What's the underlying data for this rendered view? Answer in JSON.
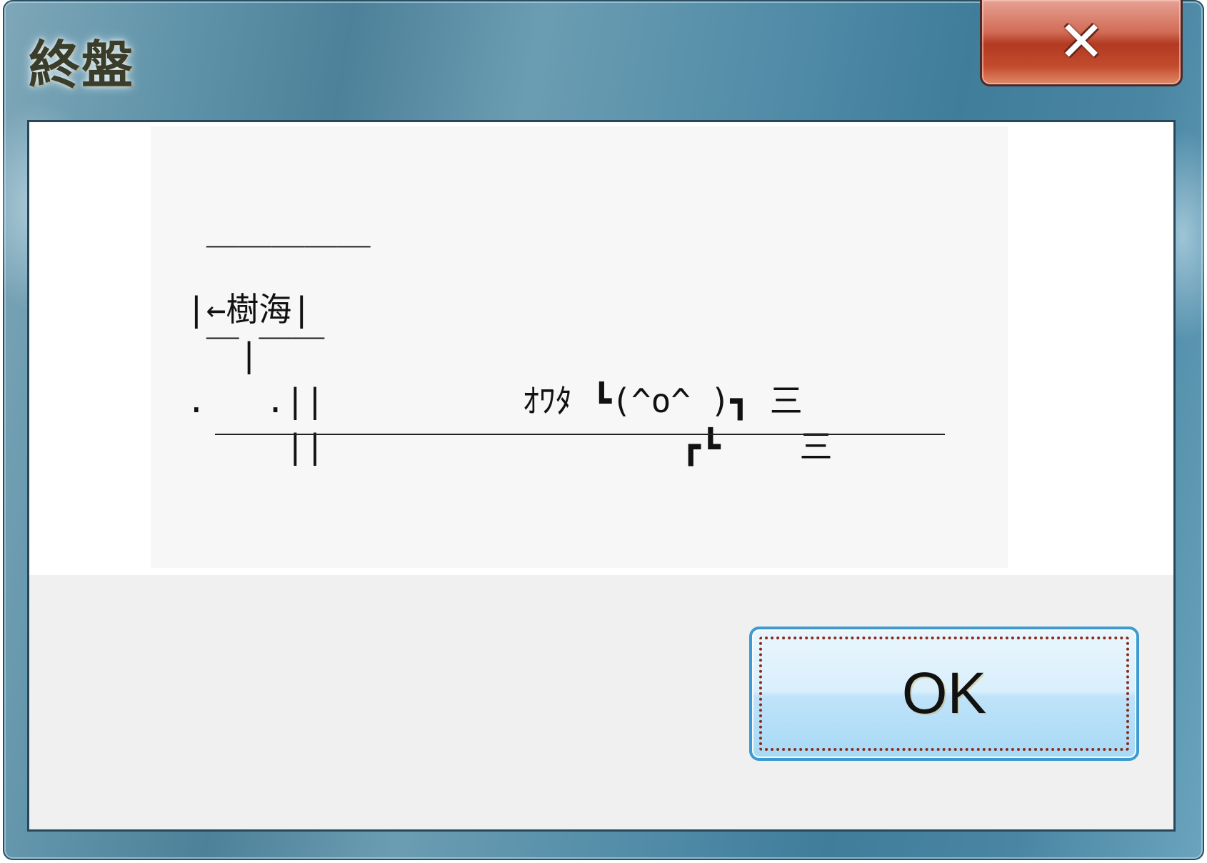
{
  "window": {
    "title": "終盤",
    "close_icon": "close-icon"
  },
  "message": {
    "ascii_art": " ￣￣￣￣￣\n|←樹海|\n ￣|￣￣\n.   .||          ｵﾜﾀ ┗(^o^ )┓ 三\n     ||                  ┏┗    三"
  },
  "buttons": {
    "ok_label": "OK"
  },
  "colors": {
    "frame_accent": "#4f8aa6",
    "close_red": "#b23a22",
    "ok_border": "#3c9bd0"
  }
}
